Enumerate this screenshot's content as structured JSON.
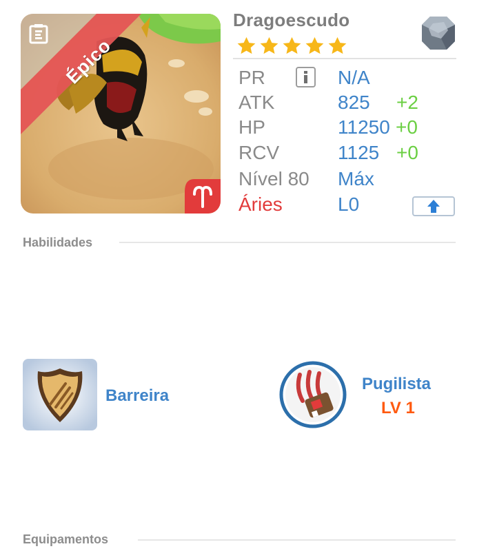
{
  "monster": {
    "name": "Dragoescudo",
    "rarity_label": "Épico",
    "star_count": 5,
    "element_icon": "gray-stone-element-icon",
    "sign_icon": "aries-icon"
  },
  "stats": [
    {
      "label": "PR",
      "value": "N/A",
      "bonus": ""
    },
    {
      "label": "ATK",
      "value": "825",
      "bonus": "+2"
    },
    {
      "label": "HP",
      "value": "11250",
      "bonus": "+0"
    },
    {
      "label": "RCV",
      "value": "1125",
      "bonus": "+0"
    },
    {
      "label": "Nível 80",
      "value": "Máx",
      "bonus": ""
    },
    {
      "label": "Áries",
      "value": "L0",
      "bonus": ""
    }
  ],
  "colors": {
    "accent_blue": "#3f84c9",
    "bonus_green": "#6bcf43",
    "sign_red": "#e23b3b",
    "level_orange": "#ff5a10",
    "epic_ribbon": "#e64c4c"
  },
  "sections": {
    "skills_title": "Habilidades",
    "equipment_title": "Equipamentos"
  },
  "skills": [
    {
      "name": "Barreira",
      "level": "",
      "icon": "shield-icon"
    },
    {
      "name": "Pugilista",
      "level": "LV 1",
      "icon": "claw-icon"
    }
  ]
}
